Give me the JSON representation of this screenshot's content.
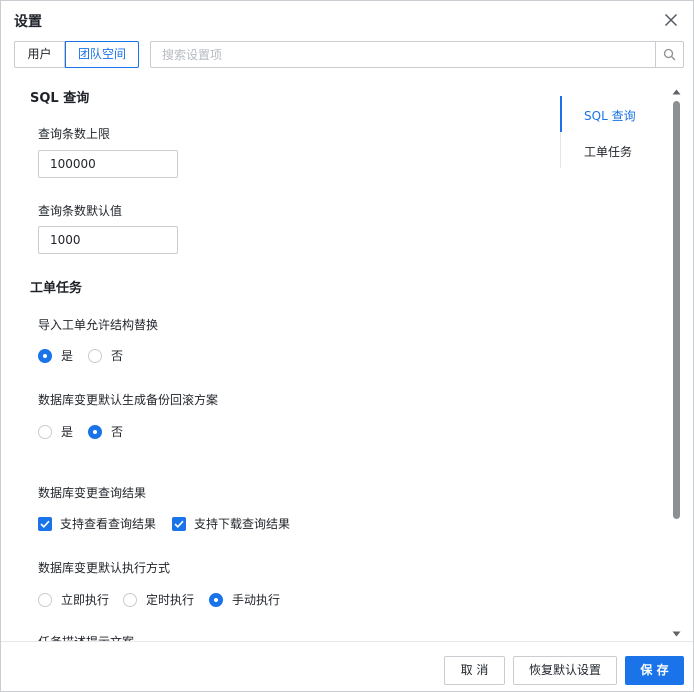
{
  "dialog": {
    "title": "设置"
  },
  "tabs": [
    {
      "label": "用户"
    },
    {
      "label": "团队空间"
    }
  ],
  "search": {
    "placeholder": "搜索设置项"
  },
  "sections": {
    "sql": {
      "title": "SQL 查询",
      "limit_label": "查询条数上限",
      "limit_value": "100000",
      "default_label": "查询条数默认值",
      "default_value": "1000"
    },
    "ticket": {
      "title": "工单任务",
      "import_label": "导入工单允许结构替换",
      "import_yes": "是",
      "import_no": "否",
      "rollback_label": "数据库变更默认生成备份回滚方案",
      "rollback_yes": "是",
      "rollback_no": "否",
      "result_label": "数据库变更查询结果",
      "result_view": "支持查看查询结果",
      "result_download": "支持下载查询结果",
      "exec_label": "数据库变更默认执行方式",
      "exec_now": "立即执行",
      "exec_timed": "定时执行",
      "exec_manual": "手动执行",
      "desc_label": "任务描述提示文案"
    }
  },
  "nav": [
    {
      "label": "SQL 查询"
    },
    {
      "label": "工单任务"
    }
  ],
  "footer": {
    "cancel": "取 消",
    "reset": "恢复默认设置",
    "save": "保 存"
  },
  "colors": {
    "accent": "#1a73e8",
    "border": "#c9ccd1",
    "text": "#1f2329"
  }
}
